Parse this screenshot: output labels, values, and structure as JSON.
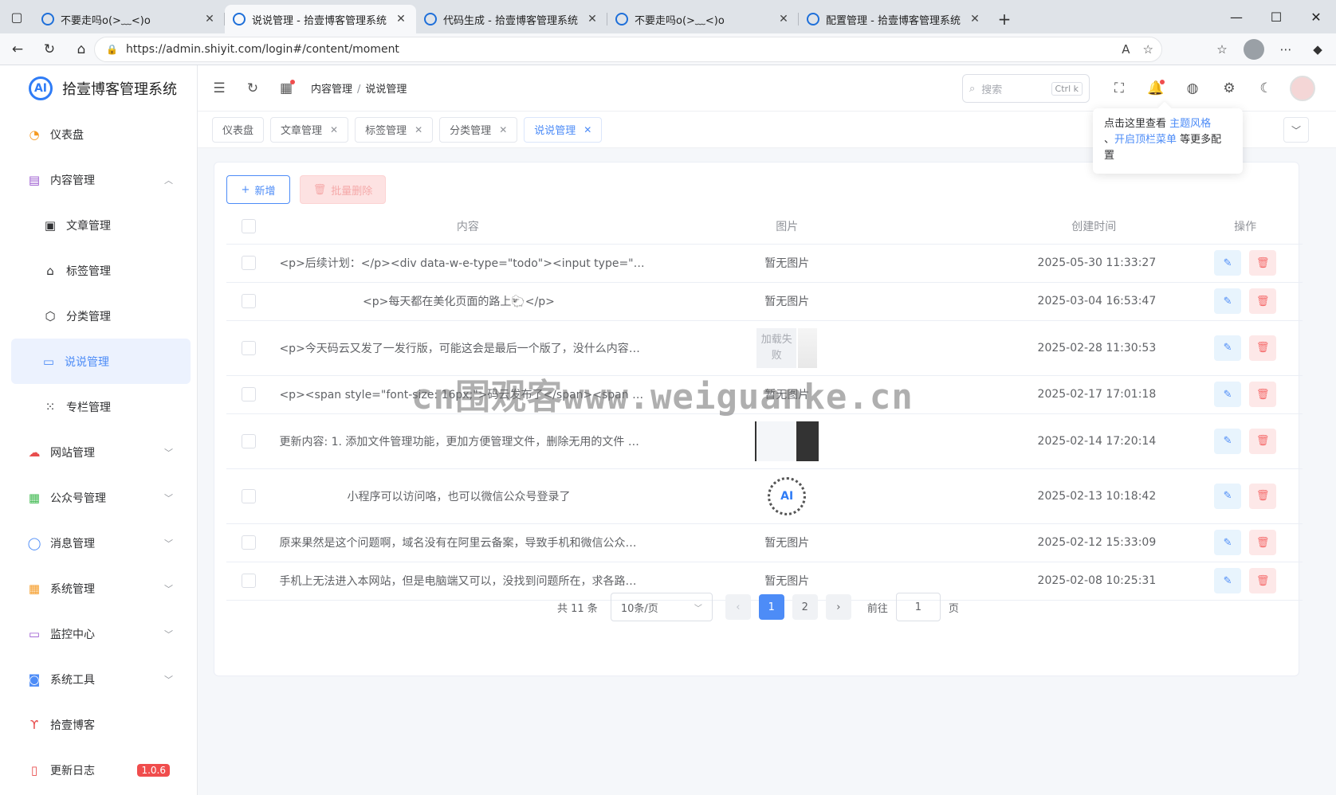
{
  "browser": {
    "tabs": [
      {
        "title": "不要走吗o(>﹏<)o",
        "active": false
      },
      {
        "title": "说说管理 - 拾壹博客管理系统",
        "active": true
      },
      {
        "title": "代码生成 - 拾壹博客管理系统",
        "active": false
      },
      {
        "title": "不要走吗o(>﹏<)o",
        "active": false
      },
      {
        "title": "配置管理 - 拾壹博客管理系统",
        "active": false
      }
    ],
    "url": "https://admin.shiyit.com/login#/content/moment"
  },
  "app": {
    "title": "拾壹博客管理系统",
    "logo_mark": "AI"
  },
  "sidebar": {
    "items": [
      {
        "label": "仪表盘",
        "icon": "dashboard-icon"
      },
      {
        "label": "内容管理",
        "icon": "content-icon"
      },
      {
        "label": "文章管理",
        "icon": "article-icon"
      },
      {
        "label": "标签管理",
        "icon": "tag-icon"
      },
      {
        "label": "分类管理",
        "icon": "cube-icon"
      },
      {
        "label": "说说管理",
        "icon": "moment-icon"
      },
      {
        "label": "专栏管理",
        "icon": "grid-icon"
      },
      {
        "label": "网站管理",
        "icon": "cloud-icon"
      },
      {
        "label": "公众号管理",
        "icon": "official-account-icon"
      },
      {
        "label": "消息管理",
        "icon": "message-icon"
      },
      {
        "label": "系统管理",
        "icon": "system-icon"
      },
      {
        "label": "监控中心",
        "icon": "monitor-icon"
      },
      {
        "label": "系统工具",
        "icon": "tools-icon"
      },
      {
        "label": "拾壹博客",
        "icon": "blog-icon"
      },
      {
        "label": "更新日志",
        "icon": "changelog-icon"
      }
    ],
    "version_badge": "1.0.6"
  },
  "topbar": {
    "breadcrumb": [
      "内容管理",
      "说说管理"
    ],
    "search_placeholder": "搜索",
    "search_kbd": "Ctrl k"
  },
  "tags": [
    {
      "label": "仪表盘",
      "closable": false
    },
    {
      "label": "文章管理",
      "closable": true
    },
    {
      "label": "标签管理",
      "closable": true
    },
    {
      "label": "分类管理",
      "closable": true
    },
    {
      "label": "说说管理",
      "closable": true
    }
  ],
  "tooltip": {
    "prefix": "点击这里查看 ",
    "link1": "主题风格",
    "mid": "、",
    "link2": "开启顶栏菜单",
    "suffix": " 等更多配置"
  },
  "toolbar": {
    "add_label": "新增",
    "batch_delete_label": "批量删除"
  },
  "table": {
    "headers": [
      "内容",
      "图片",
      "创建时间",
      "操作"
    ],
    "rows": [
      {
        "content": "<p>后续计划：</p><div data-w-e-type=\"todo\"><input type=\"checkbox\" di...",
        "image": "暂无图片",
        "time": "2025-05-30 11:33:27",
        "align": "left"
      },
      {
        "content": "<p>每天都在美化页面的路上🐑</p>",
        "image": "暂无图片",
        "time": "2025-03-04 16:53:47",
        "align": "center"
      },
      {
        "content": "<p>今天码云又发了一发行版，可能这会是最后一个版了，没什么内容可以...",
        "image": "加载失败",
        "time": "2025-02-28 11:30:53",
        "align": "left"
      },
      {
        "content": "<p><span style=\"font-size: 16px;\">码云发布了</span><span style=\"color...",
        "image": "暂无图片",
        "time": "2025-02-17 17:01:18",
        "align": "left"
      },
      {
        "content": "更新内容: 1. 添加文件管理功能，更加方便管理文件，删除无用的文件 2. ...",
        "image": "",
        "time": "2025-02-14 17:20:14",
        "align": "left"
      },
      {
        "content": "小程序可以访问咯，也可以微信公众号登录了",
        "image": "",
        "time": "2025-02-13 10:18:42",
        "align": "center"
      },
      {
        "content": "原来果然是这个问题啊，域名没有在阿里云备案，导致手机和微信公众号...",
        "image": "暂无图片",
        "time": "2025-02-12 15:33:09",
        "align": "left"
      },
      {
        "content": "手机上无法进入本网站，但是电脑端又可以，没找到问题所在，求各路大...",
        "image": "暂无图片",
        "time": "2025-02-08 10:25:31",
        "align": "left"
      }
    ]
  },
  "pagination": {
    "total": "共 11 条",
    "page_size": "10条/页",
    "pages": [
      "1",
      "2"
    ],
    "current": "1",
    "goto_label": "前往",
    "goto_value": "1",
    "page_suffix": "页"
  },
  "watermark": "cn围观客www.weiguanke.cn"
}
